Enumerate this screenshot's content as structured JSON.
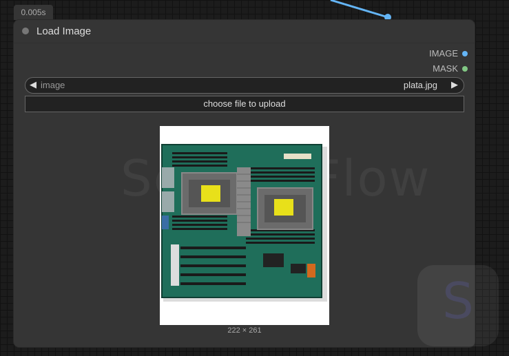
{
  "timing_badge": "0.005s",
  "node": {
    "title": "Load Image",
    "outputs": [
      {
        "label": "IMAGE",
        "color": "#64b5f6"
      },
      {
        "label": "MASK",
        "color": "#81c784"
      }
    ],
    "combo": {
      "label": "image",
      "value": "plata.jpg"
    },
    "upload_label": "choose file to upload",
    "preview_dims": "222 × 261"
  },
  "watermark_text": "SeaArt Flow",
  "brand_logo_letter": "S",
  "colors": {
    "edge": "#64b5f6",
    "node_bg": "#353535",
    "canvas_bg": "#1c1c1c"
  }
}
